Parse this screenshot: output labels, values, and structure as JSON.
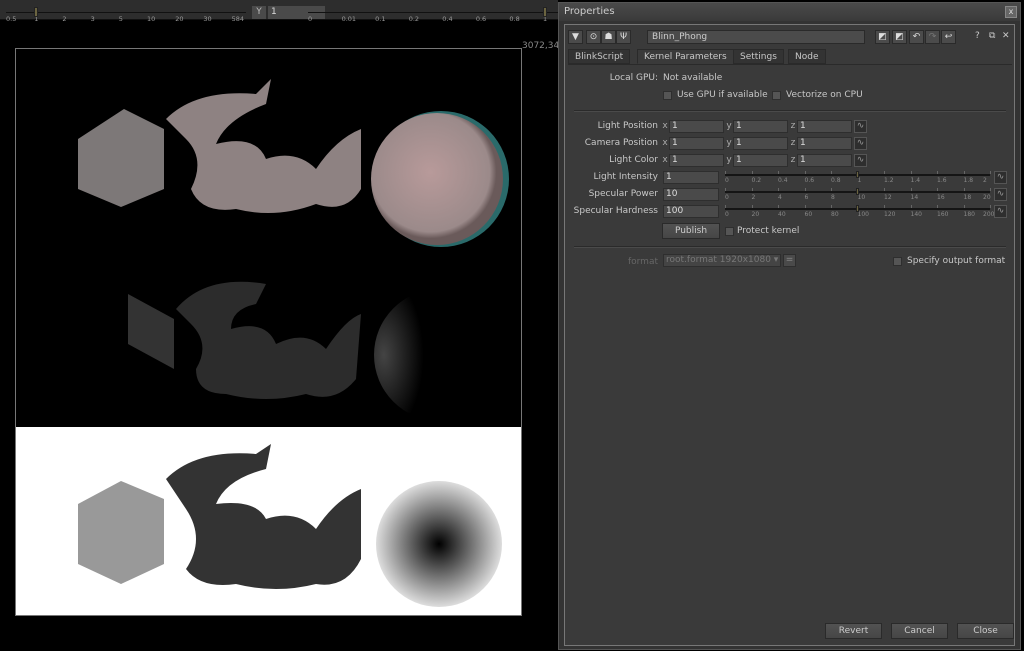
{
  "viewer": {
    "ruler_left": {
      "ticks": [
        "0.5",
        "1",
        "2",
        "3",
        "5",
        "10",
        "20",
        "30",
        "584"
      ],
      "handle": 1
    },
    "y_label": "Y",
    "y_value": "1",
    "ruler_right": {
      "ticks": [
        "0",
        "0.01",
        "0.1",
        "0.2",
        "0.4",
        "0.6",
        "0.8",
        "1"
      ],
      "handle": 1
    },
    "coord": "3072,34"
  },
  "properties": {
    "title": "Properties",
    "close": "x",
    "node_name": "Blinn_Phong",
    "toolbar_icons": [
      "collapse-icon",
      "viewer-icon",
      "node-icon",
      "wrench-icon"
    ],
    "right_icons": [
      "color-a-icon",
      "color-b-icon",
      "undo-icon",
      "redo-icon",
      "revert-icon"
    ],
    "help": "?",
    "float": "⧉",
    "close_panel": "✕",
    "tabs": [
      {
        "label": "BlinkScript"
      },
      {
        "label": "Kernel Parameters",
        "active": true
      },
      {
        "label": "Settings"
      },
      {
        "label": "Node"
      }
    ],
    "local_gpu_label": "Local GPU:",
    "local_gpu_value": "Not available",
    "use_gpu": {
      "label": "Use GPU if available",
      "checked": false
    },
    "vectorize": {
      "label": "Vectorize on CPU",
      "checked": false
    },
    "vectors": [
      {
        "label": "Light Position",
        "x": "1",
        "y": "1",
        "z": "1"
      },
      {
        "label": "Camera Position",
        "x": "1",
        "y": "1",
        "z": "1"
      },
      {
        "label": "Light Color",
        "x": "1",
        "y": "1",
        "z": "1"
      }
    ],
    "axes": [
      "x",
      "y",
      "z"
    ],
    "sliders": [
      {
        "label": "Light Intensity",
        "value": "1",
        "min": 0,
        "max": 2,
        "ticks": [
          "0",
          "0.2",
          "0.4",
          "0.6",
          "0.8",
          "1",
          "1.2",
          "1.4",
          "1.6",
          "1.8",
          "2"
        ]
      },
      {
        "label": "Specular Power",
        "value": "10",
        "min": 0,
        "max": 20,
        "ticks": [
          "0",
          "2",
          "4",
          "6",
          "8",
          "10",
          "12",
          "14",
          "16",
          "18",
          "20"
        ]
      },
      {
        "label": "Specular Hardness",
        "value": "100",
        "min": 0,
        "max": 200,
        "ticks": [
          "0",
          "20",
          "40",
          "60",
          "80",
          "100",
          "120",
          "140",
          "160",
          "180",
          "200"
        ]
      }
    ],
    "publish": "Publish",
    "protect": {
      "label": "Protect kernel",
      "checked": false
    },
    "format_label": "format",
    "format_value": "root.format 1920x1080",
    "format_btn": "=",
    "specify": {
      "label": "Specify output format",
      "checked": false
    },
    "buttons": {
      "revert": "Revert",
      "cancel": "Cancel",
      "close": "Close"
    }
  }
}
